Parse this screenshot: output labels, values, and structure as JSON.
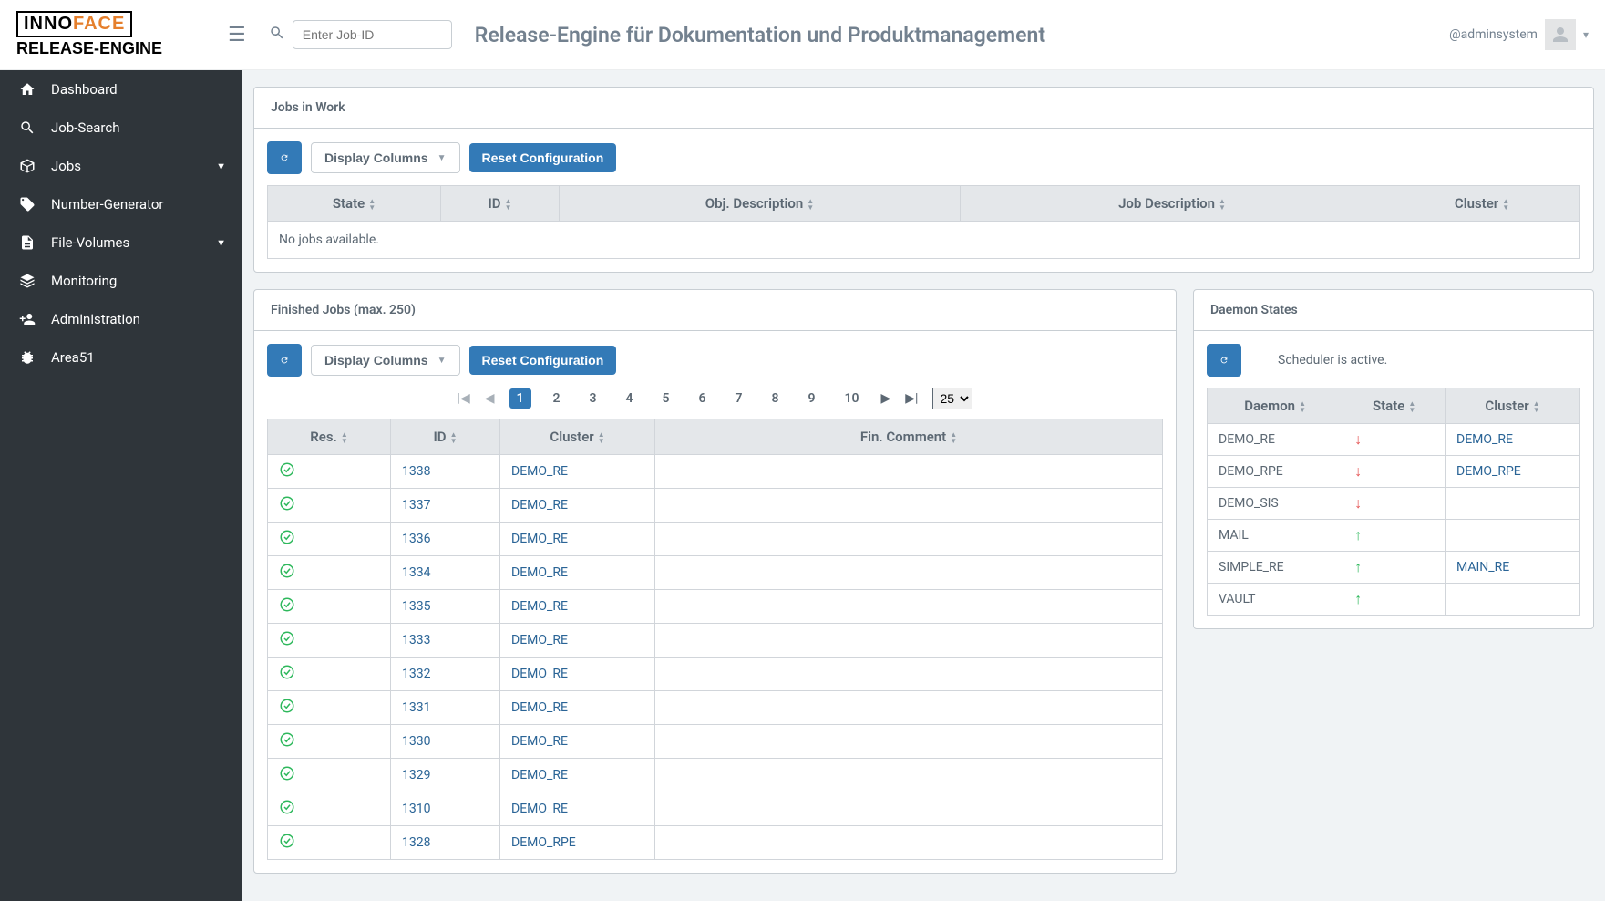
{
  "header": {
    "logo_top_1": "INNO",
    "logo_top_2": "FACE",
    "logo_bottom": "RELEASE-ENGINE",
    "search_placeholder": "Enter Job-ID",
    "title": "Release-Engine für Dokumentation und Produktmanagement",
    "username": "@adminsystem"
  },
  "sidebar": {
    "items": [
      {
        "icon": "home",
        "label": "Dashboard",
        "expandable": false
      },
      {
        "icon": "search",
        "label": "Job-Search",
        "expandable": false
      },
      {
        "icon": "cube",
        "label": "Jobs",
        "expandable": true
      },
      {
        "icon": "tag",
        "label": "Number-Generator",
        "expandable": false
      },
      {
        "icon": "file",
        "label": "File-Volumes",
        "expandable": true
      },
      {
        "icon": "monitor",
        "label": "Monitoring",
        "expandable": false
      },
      {
        "icon": "user-plus",
        "label": "Administration",
        "expandable": false
      },
      {
        "icon": "bug",
        "label": "Area51",
        "expandable": false
      }
    ]
  },
  "jobs_in_work": {
    "title": "Jobs in Work",
    "display_columns_label": "Display Columns",
    "reset_label": "Reset Configuration",
    "columns": [
      "State",
      "ID",
      "Obj. Description",
      "Job Description",
      "Cluster"
    ],
    "empty_text": "No jobs available."
  },
  "finished_jobs": {
    "title": "Finished Jobs (max. 250)",
    "display_columns_label": "Display Columns",
    "reset_label": "Reset Configuration",
    "pages": [
      "1",
      "2",
      "3",
      "4",
      "5",
      "6",
      "7",
      "8",
      "9",
      "10"
    ],
    "page_active": "1",
    "page_size": "25",
    "columns": [
      "Res.",
      "ID",
      "Cluster",
      "Fin. Comment"
    ],
    "rows": [
      {
        "res": "ok",
        "id": "1338",
        "cluster": "DEMO_RE",
        "comment": ""
      },
      {
        "res": "ok",
        "id": "1337",
        "cluster": "DEMO_RE",
        "comment": ""
      },
      {
        "res": "ok",
        "id": "1336",
        "cluster": "DEMO_RE",
        "comment": ""
      },
      {
        "res": "ok",
        "id": "1334",
        "cluster": "DEMO_RE",
        "comment": ""
      },
      {
        "res": "ok",
        "id": "1335",
        "cluster": "DEMO_RE",
        "comment": ""
      },
      {
        "res": "ok",
        "id": "1333",
        "cluster": "DEMO_RE",
        "comment": ""
      },
      {
        "res": "ok",
        "id": "1332",
        "cluster": "DEMO_RE",
        "comment": ""
      },
      {
        "res": "ok",
        "id": "1331",
        "cluster": "DEMO_RE",
        "comment": ""
      },
      {
        "res": "ok",
        "id": "1330",
        "cluster": "DEMO_RE",
        "comment": ""
      },
      {
        "res": "ok",
        "id": "1329",
        "cluster": "DEMO_RE",
        "comment": ""
      },
      {
        "res": "ok",
        "id": "1310",
        "cluster": "DEMO_RE",
        "comment": ""
      },
      {
        "res": "ok",
        "id": "1328",
        "cluster": "DEMO_RPE",
        "comment": ""
      }
    ]
  },
  "daemon": {
    "title": "Daemon States",
    "status_text": "Scheduler is active.",
    "columns": [
      "Daemon",
      "State",
      "Cluster"
    ],
    "rows": [
      {
        "name": "DEMO_RE",
        "state": "down",
        "cluster": "DEMO_RE"
      },
      {
        "name": "DEMO_RPE",
        "state": "down",
        "cluster": "DEMO_RPE"
      },
      {
        "name": "DEMO_SIS",
        "state": "down",
        "cluster": ""
      },
      {
        "name": "MAIL",
        "state": "up",
        "cluster": ""
      },
      {
        "name": "SIMPLE_RE",
        "state": "up",
        "cluster": "MAIN_RE"
      },
      {
        "name": "VAULT",
        "state": "up",
        "cluster": ""
      }
    ]
  }
}
